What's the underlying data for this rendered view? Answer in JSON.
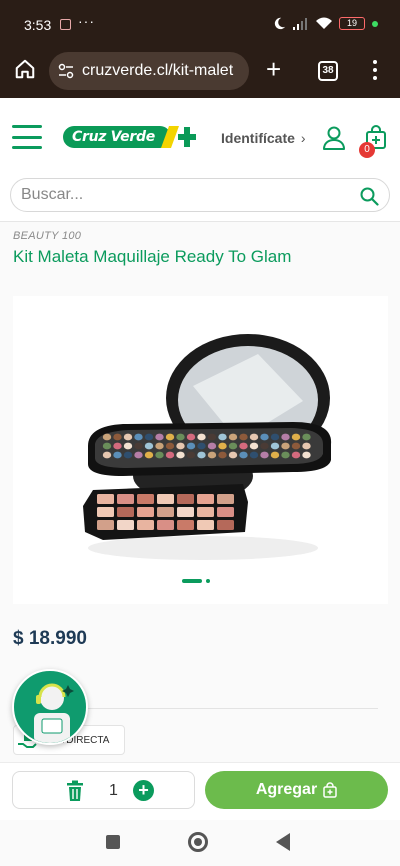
{
  "status_bar": {
    "time": "3:53",
    "dots": "···",
    "battery": "19"
  },
  "browser": {
    "url": "cruzverde.cl/kit-malet",
    "tab_count": "38"
  },
  "header": {
    "logo_text": "Cruz Verde",
    "login_label": "Identifícate",
    "login_chevron": "›",
    "cart_count": "0"
  },
  "search": {
    "placeholder": "Buscar..."
  },
  "product": {
    "brand": "BEAUTY 100",
    "title": "Kit Maleta Maquillaje Ready To Glam",
    "price": "$ 18.990",
    "delivery_label": "TA DIRECTA",
    "gallery_total": 2,
    "gallery_active": 1
  },
  "cart_bar": {
    "quantity": "1",
    "plus": "+",
    "add_label": "Agregar"
  },
  "colors": {
    "brand_green": "#0b9b5d",
    "add_button": "#6cbb4c",
    "price": "#1e3a55",
    "badge": "#e53935"
  }
}
